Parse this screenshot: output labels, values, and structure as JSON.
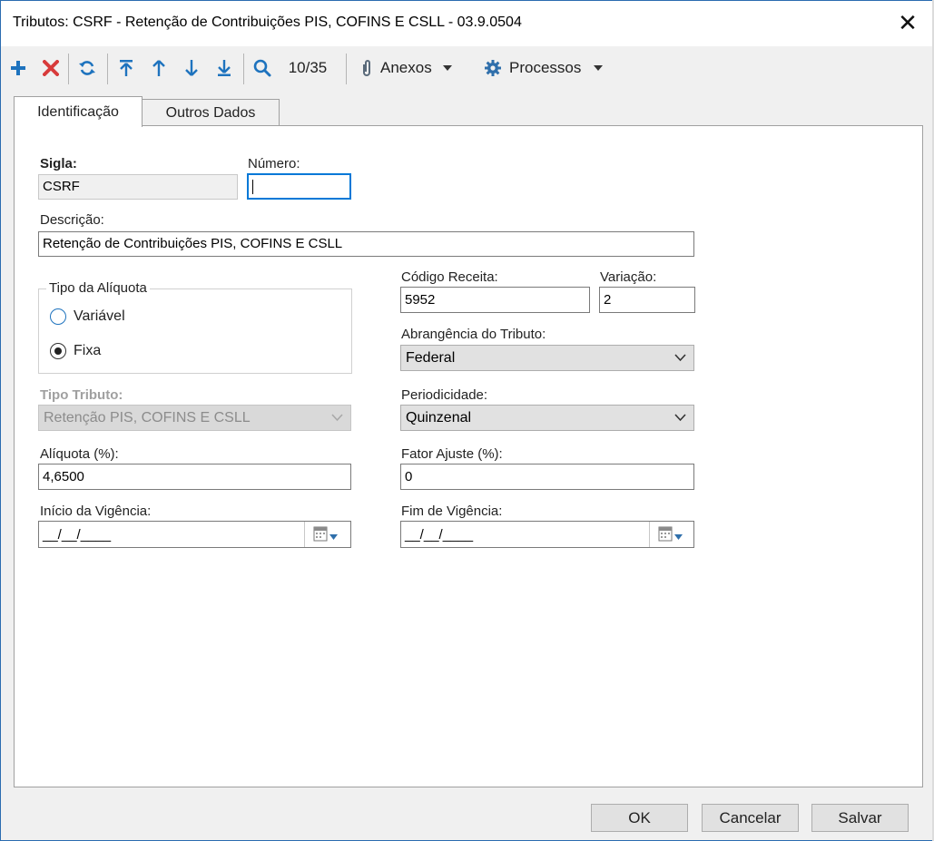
{
  "window": {
    "title": "Tributos: CSRF - Retenção de Contribuições PIS, COFINS E CSLL - 03.9.0504"
  },
  "toolbar": {
    "icons": [
      "plus-icon",
      "delete-x-icon",
      "refresh-icon",
      "first-record-icon",
      "previous-record-icon",
      "next-record-icon",
      "last-record-icon",
      "search-icon"
    ],
    "record_counter": "10/35",
    "anexos_label": "Anexos",
    "processos_label": "Processos"
  },
  "tabs": [
    {
      "label": "Identificação",
      "active": true
    },
    {
      "label": "Outros Dados",
      "active": false
    }
  ],
  "form": {
    "sigla_label": "Sigla:",
    "sigla_value": "CSRF",
    "numero_label": "Número:",
    "numero_value": "",
    "descricao_label": "Descrição:",
    "descricao_value": "Retenção de Contribuições PIS, COFINS E CSLL",
    "tipo_aliquota": {
      "legend": "Tipo da Alíquota",
      "options": [
        {
          "label": "Variável",
          "checked": false
        },
        {
          "label": "Fixa",
          "checked": true
        }
      ]
    },
    "codigo_receita_label": "Código Receita:",
    "codigo_receita_value": "5952",
    "variacao_label": "Variação:",
    "variacao_value": "2",
    "abrangencia_label": "Abrangência do Tributo:",
    "abrangencia_value": "Federal",
    "tipo_tributo_label": "Tipo Tributo:",
    "tipo_tributo_value": "Retenção PIS, COFINS E CSLL",
    "periodicidade_label": "Periodicidade:",
    "periodicidade_value": "Quinzenal",
    "aliquota_label": "Alíquota (%):",
    "aliquota_value": "4,6500",
    "fator_ajuste_label": "Fator Ajuste (%):",
    "fator_ajuste_value": "0",
    "inicio_vigencia_label": "Início da Vigência:",
    "inicio_vigencia_value": "__/__/____",
    "fim_vigencia_label": "Fim de Vigência:",
    "fim_vigencia_value": "__/__/____"
  },
  "buttons": {
    "ok": "OK",
    "cancelar": "Cancelar",
    "salvar": "Salvar"
  },
  "colors": {
    "accent_blue": "#1e73be",
    "delete_red": "#d83b3b",
    "focus_border": "#0078d7"
  }
}
